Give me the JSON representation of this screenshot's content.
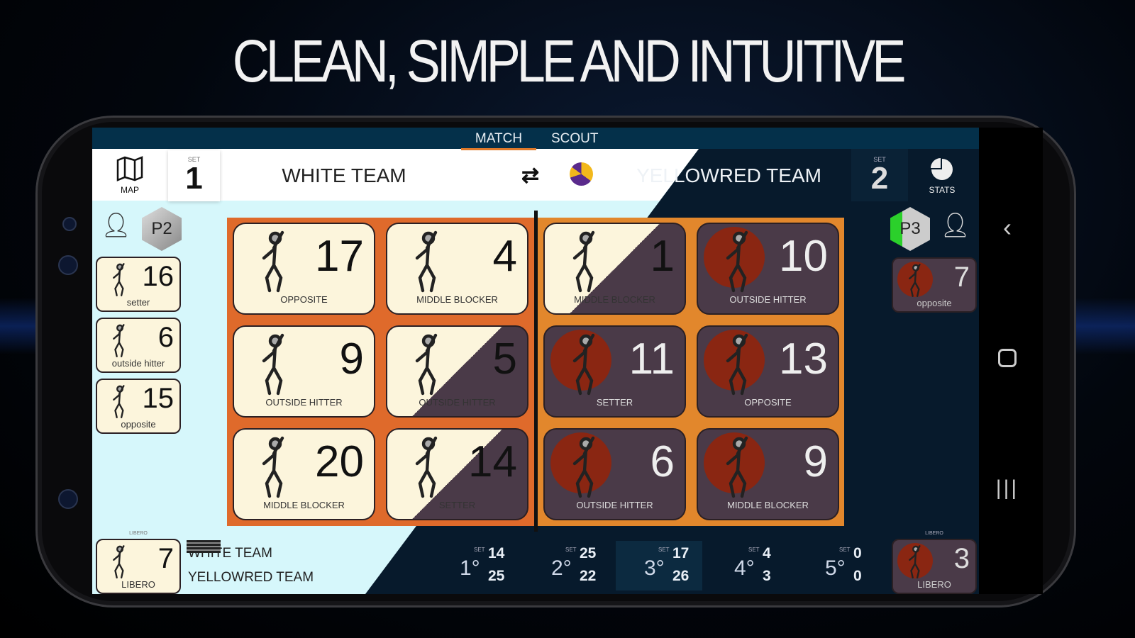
{
  "headline": "CLEAN, SIMPLE AND INTUITIVE",
  "tabs": [
    {
      "label": "MATCH",
      "active": true
    },
    {
      "label": "SCOUT",
      "active": false
    }
  ],
  "header": {
    "map_label": "MAP",
    "set_label": "SET",
    "home_set": "1",
    "home_team": "WHITE TEAM",
    "away_team": "YELLOWRED TEAM",
    "away_set": "2",
    "stats_label": "STATS"
  },
  "rotation": {
    "home": "P2",
    "away": "P3"
  },
  "court": {
    "home": [
      {
        "number": "17",
        "role": "OPPOSITE"
      },
      {
        "number": "4",
        "role": "MIDDLE BLOCKER"
      },
      {
        "number": "9",
        "role": "OUTSIDE HITTER"
      },
      {
        "number": "5",
        "role": "OUTSIDE HITTER"
      },
      {
        "number": "20",
        "role": "MIDDLE BLOCKER"
      },
      {
        "number": "14",
        "role": "SETTER"
      }
    ],
    "away": [
      {
        "number": "1",
        "role": "MIDDLE BLOCKER"
      },
      {
        "number": "10",
        "role": "OUTSIDE HITTER"
      },
      {
        "number": "11",
        "role": "SETTER"
      },
      {
        "number": "13",
        "role": "OPPOSITE"
      },
      {
        "number": "6",
        "role": "OUTSIDE HITTER"
      },
      {
        "number": "9",
        "role": "MIDDLE BLOCKER"
      }
    ]
  },
  "bench": {
    "home": [
      {
        "number": "16",
        "role": "setter"
      },
      {
        "number": "6",
        "role": "outside hitter"
      },
      {
        "number": "15",
        "role": "opposite"
      }
    ],
    "away": [
      {
        "number": "7",
        "role": "opposite"
      }
    ]
  },
  "libero": {
    "caption": "LIBERO",
    "home": {
      "number": "7",
      "role": "LIBERO"
    },
    "away": {
      "number": "3",
      "role": "LIBERO"
    }
  },
  "scoreboard": {
    "home_team": "WHITE TEAM",
    "away_team": "YELLOWRED TEAM",
    "set_label": "SET",
    "sets": [
      {
        "ordinal": "1°",
        "home": "14",
        "away": "25"
      },
      {
        "ordinal": "2°",
        "home": "25",
        "away": "22"
      },
      {
        "ordinal": "3°",
        "home": "17",
        "away": "26",
        "current": true
      },
      {
        "ordinal": "4°",
        "home": "4",
        "away": "3"
      },
      {
        "ordinal": "5°",
        "home": "0",
        "away": "0"
      }
    ]
  },
  "colors": {
    "accent": "#e07a2a",
    "court_home": "#df6a2b",
    "court_away": "#e2872c",
    "navy": "#071a2c",
    "card": "#fcf5dc",
    "card_dark": "#4a3a48",
    "player_circle": "#8a2612"
  }
}
